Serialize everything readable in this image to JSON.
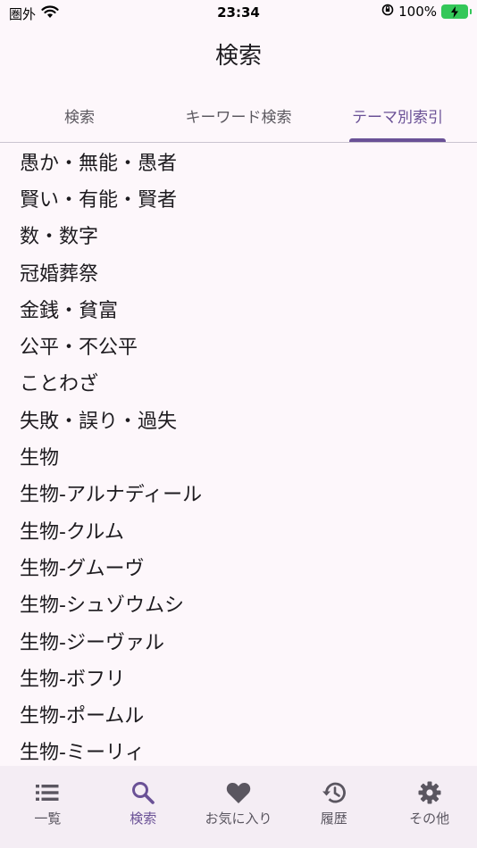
{
  "status_bar": {
    "carrier": "圏外",
    "time": "23:34",
    "battery": "100%"
  },
  "app_title": "検索",
  "tabs": [
    {
      "label": "検索"
    },
    {
      "label": "キーワード検索"
    },
    {
      "label": "テーマ別索引"
    }
  ],
  "active_tab": "テーマ別索引",
  "list": [
    {
      "label": "愚か・無能・愚者"
    },
    {
      "label": "賢い・有能・賢者"
    },
    {
      "label": "数・数字"
    },
    {
      "label": "冠婚葬祭"
    },
    {
      "label": "金銭・貧富"
    },
    {
      "label": "公平・不公平"
    },
    {
      "label": "ことわざ"
    },
    {
      "label": "失敗・誤り・過失"
    },
    {
      "label": "生物"
    },
    {
      "label": "生物-アルナディール"
    },
    {
      "label": "生物-クルム"
    },
    {
      "label": "生物-グムーヴ"
    },
    {
      "label": "生物-シュゾウムシ"
    },
    {
      "label": "生物-ジーヴァル"
    },
    {
      "label": "生物-ボフリ"
    },
    {
      "label": "生物-ポームル"
    },
    {
      "label": "生物-ミーリィ"
    }
  ],
  "bottom_nav": [
    {
      "label": "一覧",
      "icon": "list-icon"
    },
    {
      "label": "検索",
      "icon": "search-icon"
    },
    {
      "label": "お気に入り",
      "icon": "heart-icon"
    },
    {
      "label": "履歴",
      "icon": "history-icon"
    },
    {
      "label": "その他",
      "icon": "gear-icon"
    }
  ],
  "colors": {
    "accent": "#6a5196",
    "background": "#fdf7fb",
    "nav_background": "#f4edf4",
    "battery": "#34c759"
  }
}
